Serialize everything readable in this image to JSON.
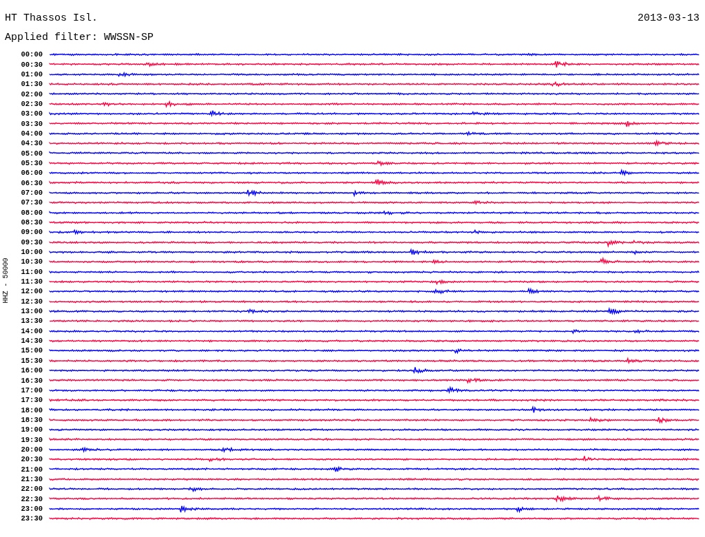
{
  "header": {
    "station": "HT Thassos Isl.",
    "date": "2013-03-13",
    "filter": "Applied filter: WWSSN-SP"
  },
  "axis_label": "HHZ - 50000",
  "traces": [
    {
      "time": "00:00",
      "color": "#0000ff"
    },
    {
      "time": "00:30",
      "color": "#ff0040"
    },
    {
      "time": "01:00",
      "color": "#0000ff"
    },
    {
      "time": "01:30",
      "color": "#ff0040"
    },
    {
      "time": "02:00",
      "color": "#0000ff"
    },
    {
      "time": "02:30",
      "color": "#ff0040"
    },
    {
      "time": "03:00",
      "color": "#0000ff"
    },
    {
      "time": "03:30",
      "color": "#ff0040"
    },
    {
      "time": "04:00",
      "color": "#0000ff"
    },
    {
      "time": "04:30",
      "color": "#ff0040"
    },
    {
      "time": "05:00",
      "color": "#0000ff"
    },
    {
      "time": "05:30",
      "color": "#ff0040"
    },
    {
      "time": "06:00",
      "color": "#0000ff"
    },
    {
      "time": "06:30",
      "color": "#ff0040"
    },
    {
      "time": "07:00",
      "color": "#0000ff"
    },
    {
      "time": "07:30",
      "color": "#ff0040"
    },
    {
      "time": "08:00",
      "color": "#0000ff"
    },
    {
      "time": "08:30",
      "color": "#ff0040"
    },
    {
      "time": "09:00",
      "color": "#0000ff"
    },
    {
      "time": "09:30",
      "color": "#ff0040"
    },
    {
      "time": "10:00",
      "color": "#0000ff"
    },
    {
      "time": "10:30",
      "color": "#ff0040"
    },
    {
      "time": "11:00",
      "color": "#0000ff"
    },
    {
      "time": "11:30",
      "color": "#ff0040"
    },
    {
      "time": "12:00",
      "color": "#0000ff"
    },
    {
      "time": "12:30",
      "color": "#ff0040"
    },
    {
      "time": "13:00",
      "color": "#0000ff"
    },
    {
      "time": "13:30",
      "color": "#ff0040"
    },
    {
      "time": "14:00",
      "color": "#0000ff"
    },
    {
      "time": "14:30",
      "color": "#ff0040"
    },
    {
      "time": "15:00",
      "color": "#0000ff"
    },
    {
      "time": "15:30",
      "color": "#ff0040"
    },
    {
      "time": "16:00",
      "color": "#0000ff"
    },
    {
      "time": "16:30",
      "color": "#ff0040"
    },
    {
      "time": "17:00",
      "color": "#0000ff"
    },
    {
      "time": "17:30",
      "color": "#ff0040"
    },
    {
      "time": "18:00",
      "color": "#0000ff"
    },
    {
      "time": "18:30",
      "color": "#ff0040"
    },
    {
      "time": "19:00",
      "color": "#0000ff"
    },
    {
      "time": "19:30",
      "color": "#ff0040"
    },
    {
      "time": "20:00",
      "color": "#0000ff"
    },
    {
      "time": "20:30",
      "color": "#ff0040"
    },
    {
      "time": "21:00",
      "color": "#0000ff"
    },
    {
      "time": "21:30",
      "color": "#ff0040"
    },
    {
      "time": "22:00",
      "color": "#0000ff"
    },
    {
      "time": "22:30",
      "color": "#ff0040"
    },
    {
      "time": "23:00",
      "color": "#0000ff"
    },
    {
      "time": "23:30",
      "color": "#ff0040"
    }
  ]
}
